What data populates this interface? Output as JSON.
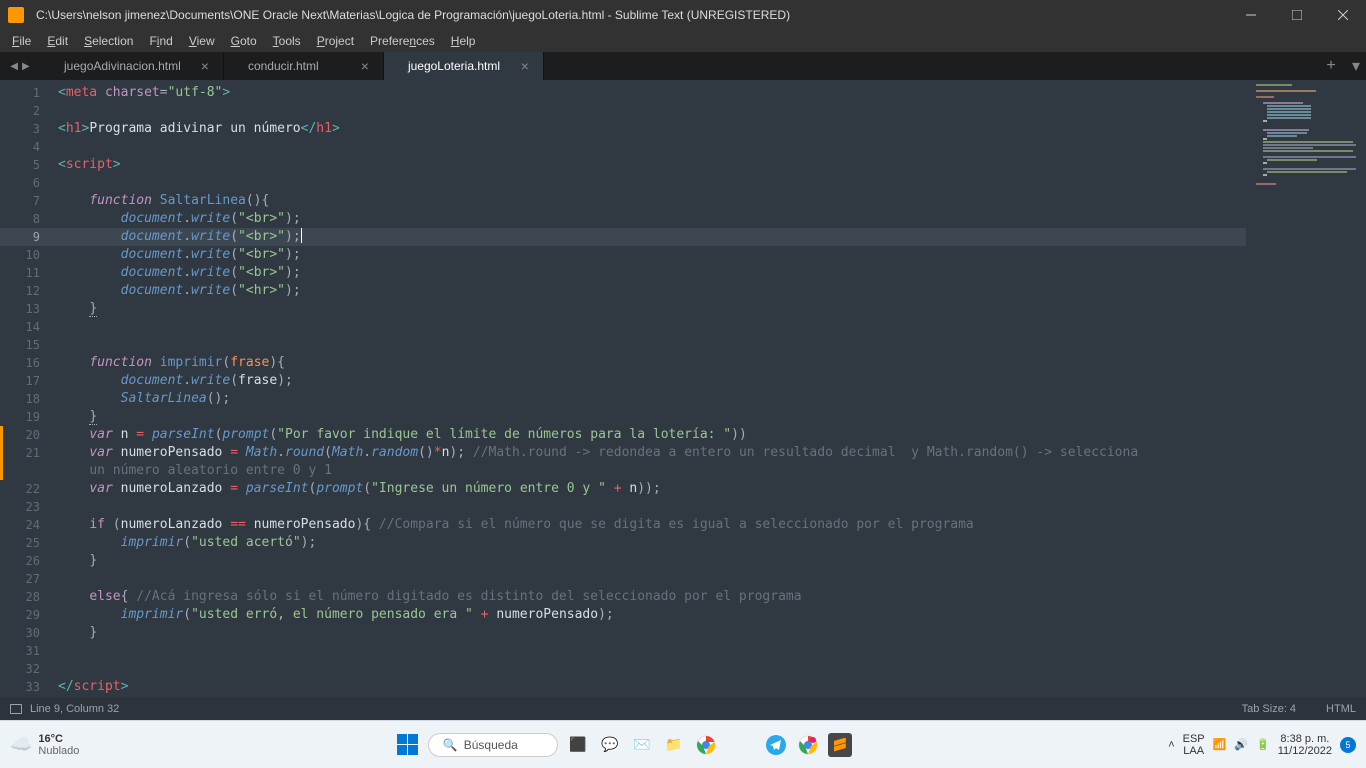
{
  "titlebar": {
    "title": "C:\\Users\\nelson jimenez\\Documents\\ONE Oracle Next\\Materias\\Logica de Programación\\juegoLoteria.html - Sublime Text (UNREGISTERED)"
  },
  "menu": {
    "file": "File",
    "edit": "Edit",
    "selection": "Selection",
    "find": "Find",
    "view": "View",
    "goto": "Goto",
    "tools": "Tools",
    "project": "Project",
    "preferences": "Preferences",
    "help": "Help"
  },
  "tabs": {
    "items": [
      {
        "label": "juegoAdivinacion.html",
        "active": false
      },
      {
        "label": "conducir.html",
        "active": false
      },
      {
        "label": "juegoLoteria.html",
        "active": true
      }
    ]
  },
  "code": {
    "heading": "Programa adivinar un número",
    "meta_utf": "\"utf-8\"",
    "fn1": "SaltarLinea",
    "fn2": "imprimir",
    "param_frase": "frase",
    "br": "\"<br>\"",
    "hr": "\"<hr>\"",
    "prompt1": "\"Por favor indique el límite de números para la lotería: \"",
    "prompt2": "\"Ingrese un número entre 0 y \"",
    "acerto": "\"usted acertó\"",
    "erro": "\"usted erró, el número pensado era \"",
    "comment_round": "//Math.round -> redondea a entero un resultado decimal  y Math.random() -> selecciona ",
    "comment_round2": "un número aleatorio entre 0 y 1",
    "comment_if": "//Compara si el número que se digita es igual a seleccionado por el programa",
    "comment_else": "//Acá ingresa sólo si el número digitado es distinto del seleccionado por el programa"
  },
  "status": {
    "cursor": "Line 9, Column 32",
    "tabsize": "Tab Size: 4",
    "lang": "HTML"
  },
  "taskbar": {
    "temp": "16°C",
    "weather": "Nublado",
    "search": "Búsqueda",
    "lang1": "ESP",
    "lang2": "LAA",
    "time": "8:38 p. m.",
    "date": "11/12/2022"
  }
}
